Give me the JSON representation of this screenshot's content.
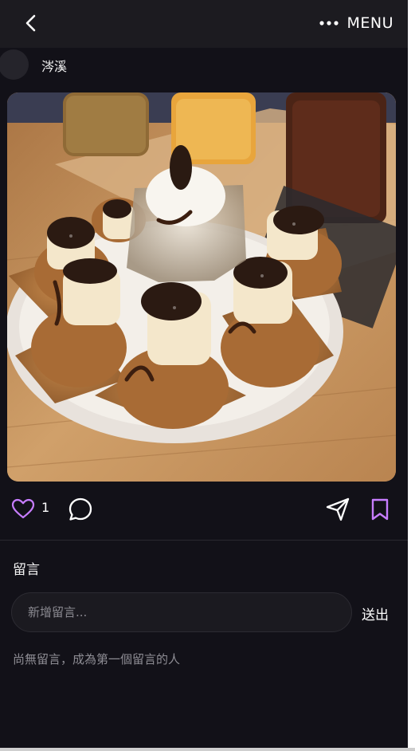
{
  "header": {
    "menu_label": "MENU"
  },
  "post": {
    "author_name": "涔溪",
    "like_count": "1"
  },
  "comments": {
    "title": "留言",
    "input_placeholder": "新增留言...",
    "send_label": "送出",
    "empty_message": "尚無留言，成為第一個留言的人"
  },
  "colors": {
    "background": "#121118",
    "topbar": "#1c1b20",
    "accent": "#c77dff"
  },
  "icons": {
    "back": "chevron-left-icon",
    "more": "more-horizontal-icon",
    "like": "heart-icon",
    "comment": "comment-bubble-icon",
    "share": "send-icon",
    "save": "bookmark-icon"
  }
}
